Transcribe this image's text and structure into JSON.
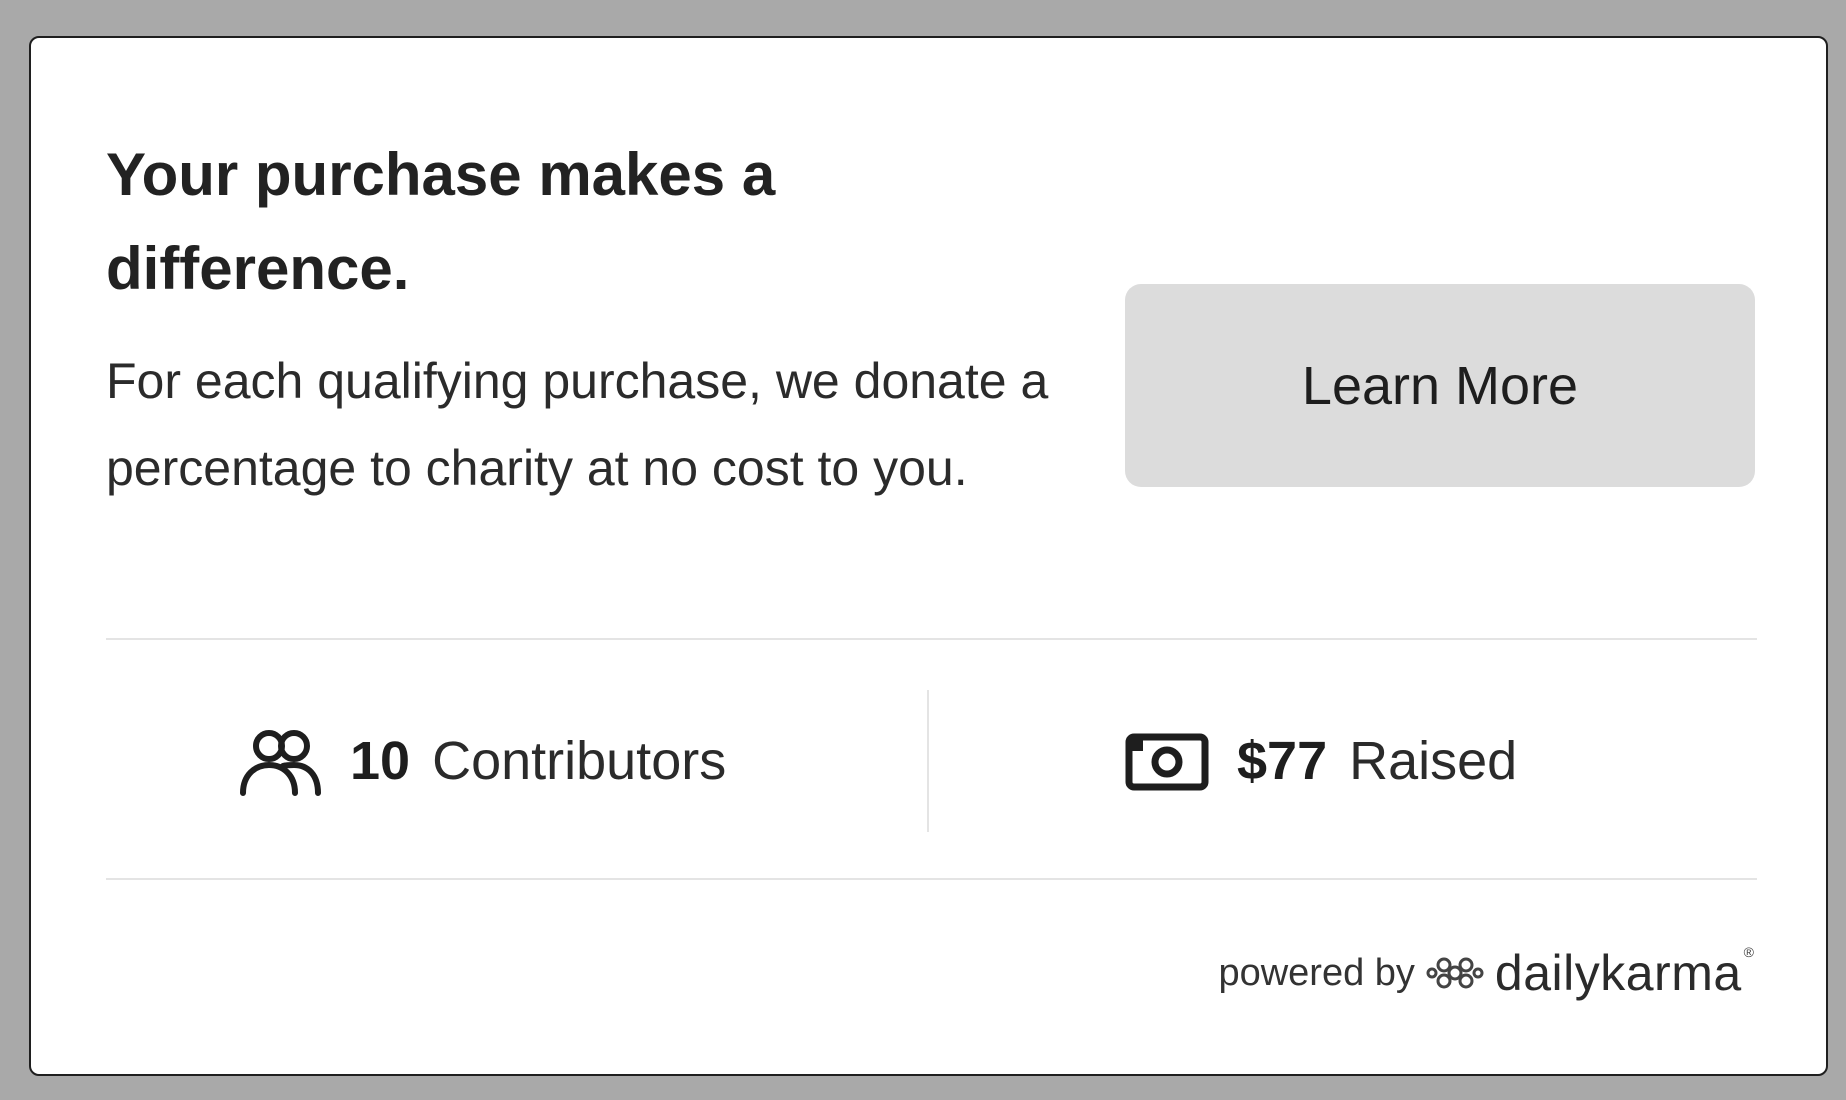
{
  "widget": {
    "headline": "Your purchase makes a difference.",
    "body": "For each qualifying purchase, we donate a percentage to charity at no cost to you.",
    "learn_more_label": "Learn More"
  },
  "stats": {
    "contributors": {
      "icon": "people-icon",
      "count": "10",
      "label": "Contributors"
    },
    "raised": {
      "icon": "money-icon",
      "amount": "$77",
      "label": "Raised"
    }
  },
  "footer": {
    "powered_by": "powered by",
    "logo_icon": "dailykarma-logo-icon",
    "brand": "dailykarma",
    "registered_mark": "®"
  },
  "colors": {
    "page_background": "#a9a9a9",
    "card_background": "#ffffff",
    "button_background": "#dcdcdc",
    "text": "#222222",
    "divider": "#e4e4e4"
  }
}
